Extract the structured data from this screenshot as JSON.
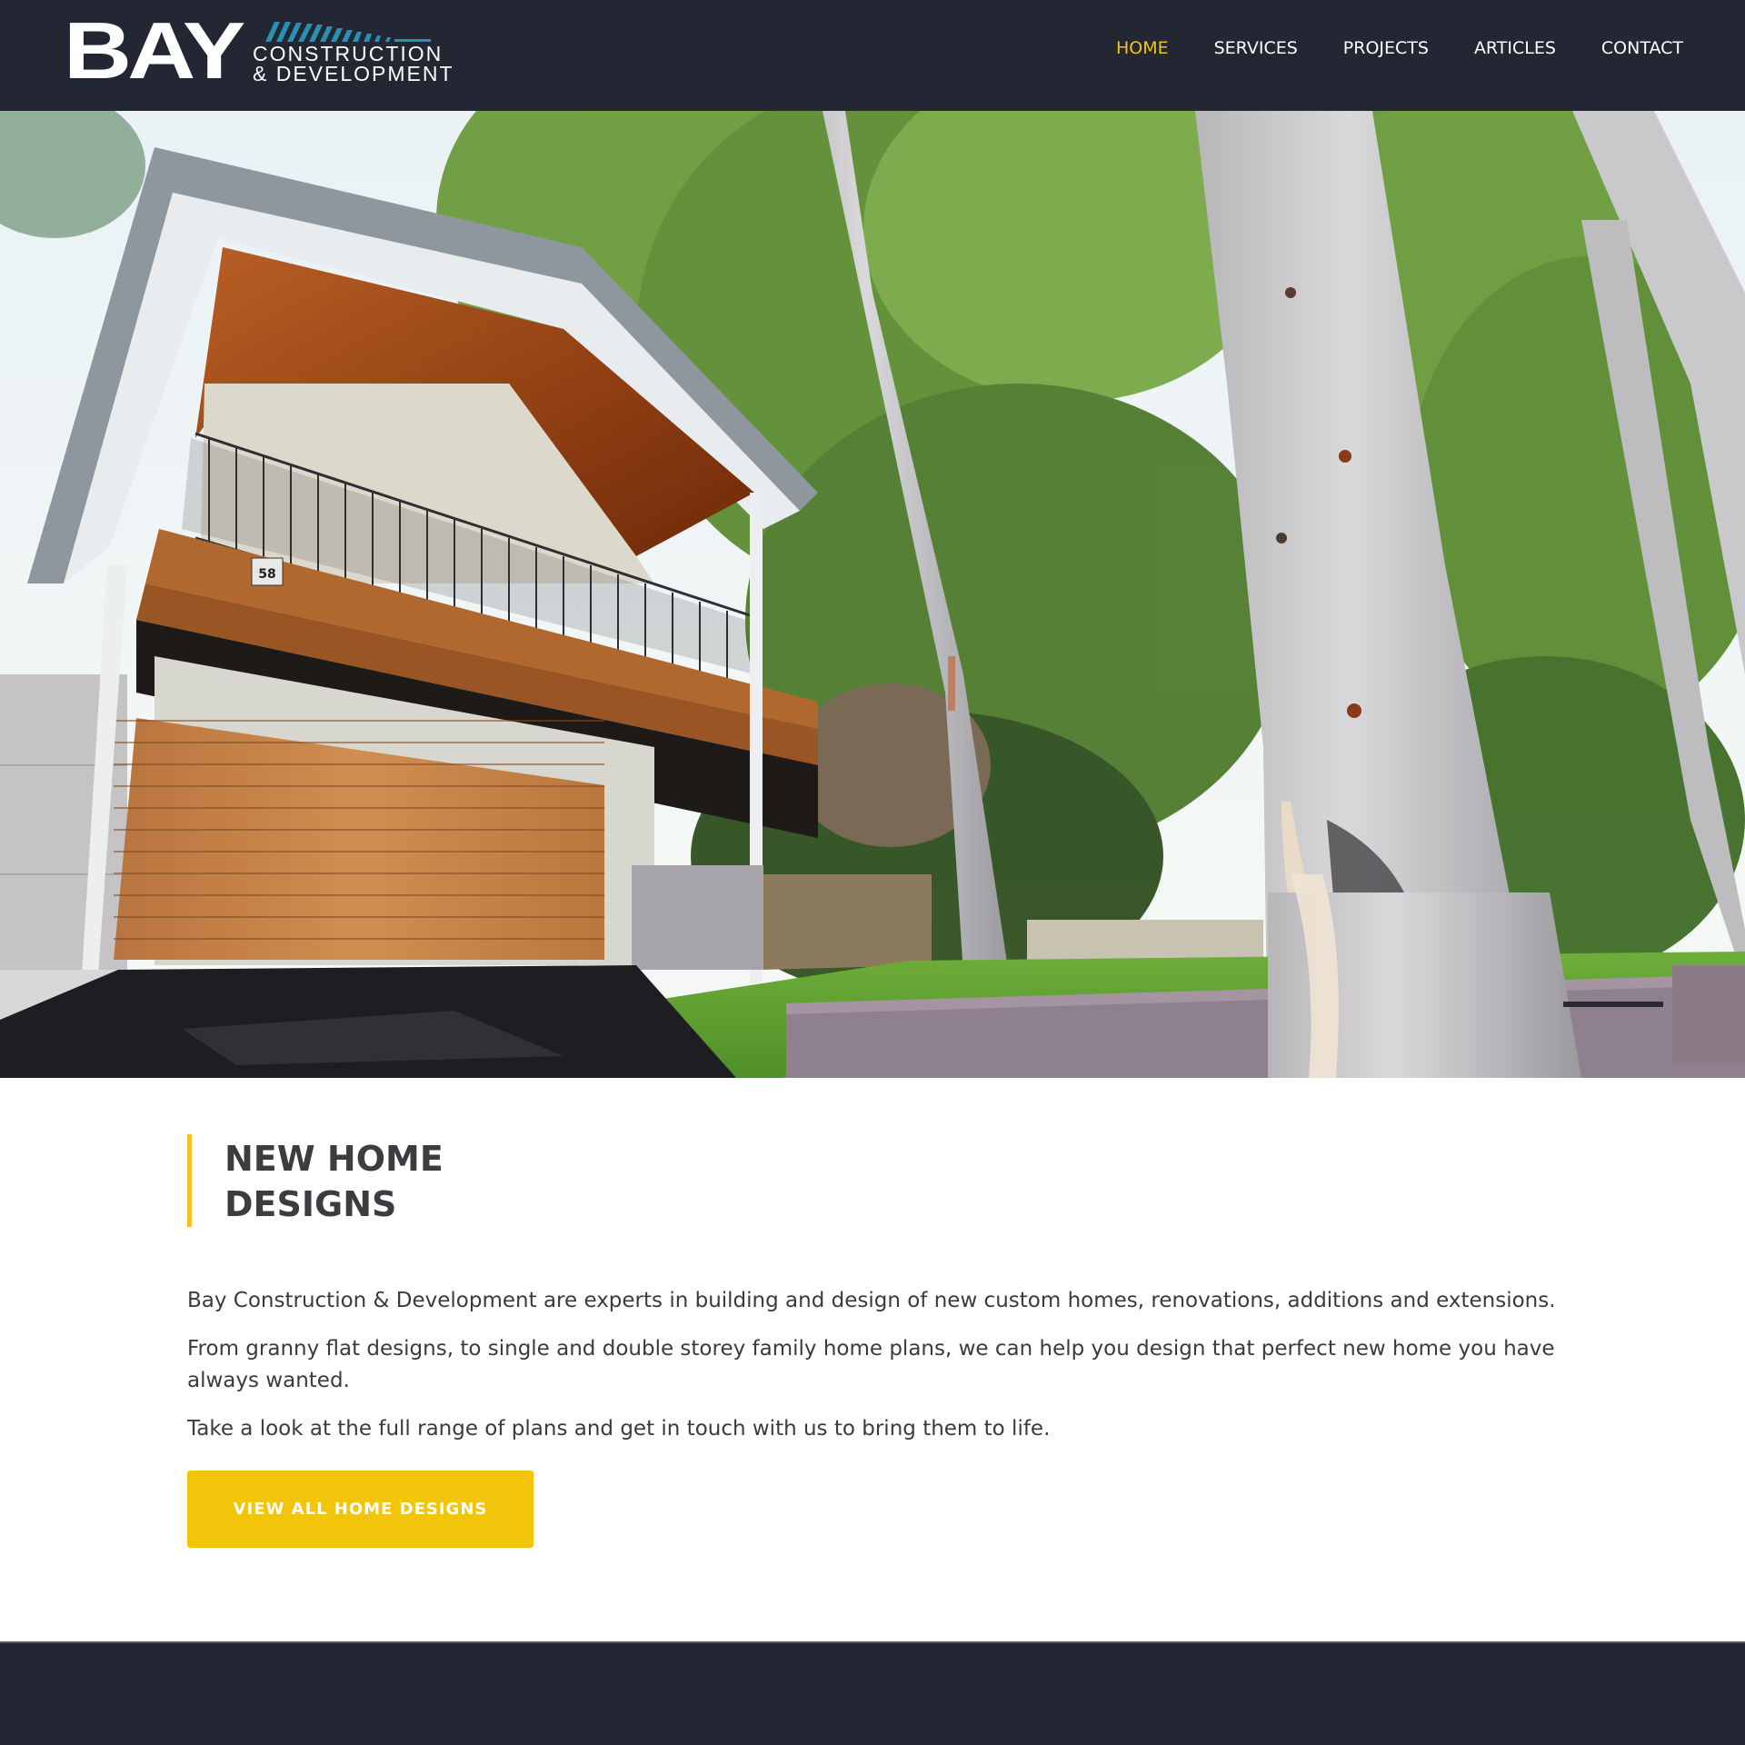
{
  "brand": {
    "logo_main": "BAY",
    "logo_line1": "CONSTRUCTION",
    "logo_line2": "& DEVELOPMENT",
    "accent_color": "#f2c31b",
    "logo_accent_color": "#2a8fb0",
    "header_bg": "#232633"
  },
  "nav": {
    "items": [
      {
        "label": "HOME",
        "active": true
      },
      {
        "label": "SERVICES",
        "active": false
      },
      {
        "label": "PROJECTS",
        "active": false
      },
      {
        "label": "ARTICLES",
        "active": false
      },
      {
        "label": "CONTACT",
        "active": false
      }
    ]
  },
  "hero": {
    "alt": "Two-storey home with timber garage door, balcony and eucalyptus trees",
    "house_number": "58"
  },
  "section": {
    "heading": "NEW HOME\nDESIGNS",
    "paragraphs": [
      "Bay Construction & Development are experts in building and design of new custom homes, renovations, additions and extensions.",
      "From granny flat designs, to single and double storey family home plans, we can help you design that perfect new home you have always wanted.",
      "Take a look at the full range of plans and get in touch with us to bring them to life."
    ],
    "cta_label": "VIEW ALL HOME DESIGNS",
    "cta_color": "#f2c50a"
  }
}
